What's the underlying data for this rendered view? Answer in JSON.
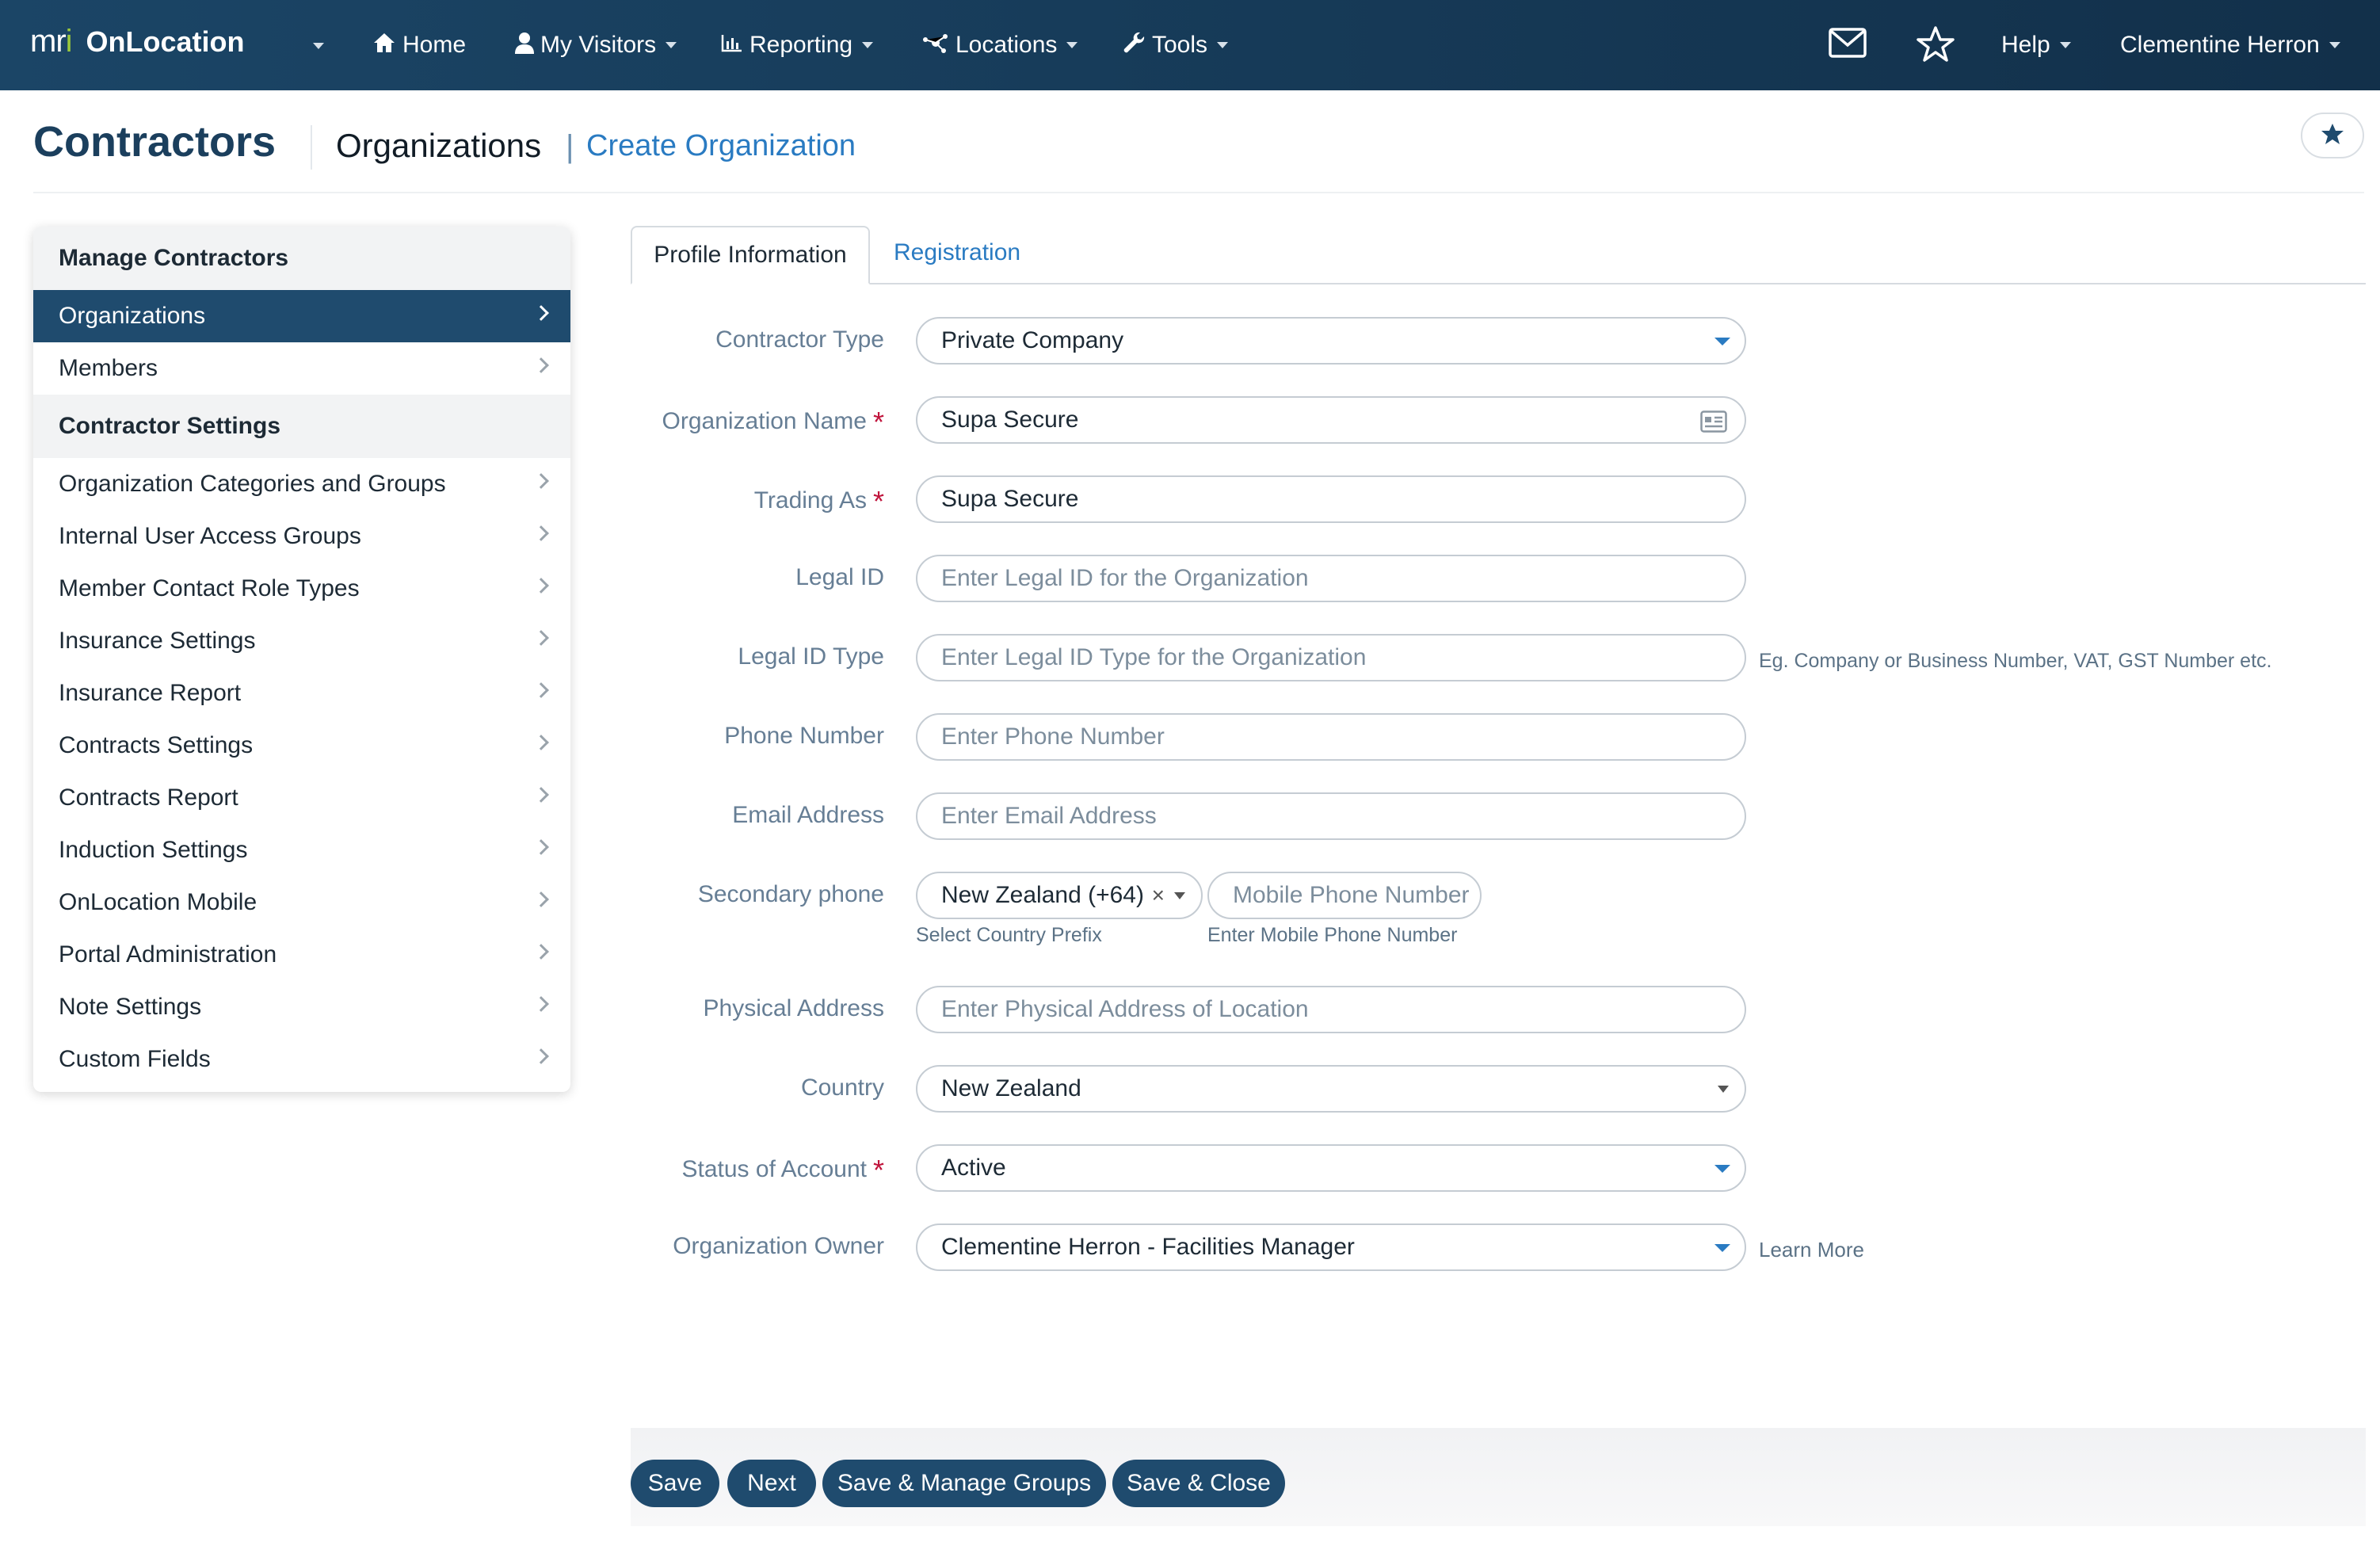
{
  "nav": {
    "logo_text": "mri",
    "app_name": "OnLocation",
    "home": "Home",
    "my_visitors": "My Visitors",
    "reporting": "Reporting",
    "locations": "Locations",
    "tools": "Tools",
    "help": "Help",
    "user": "Clementine Herron"
  },
  "header": {
    "title": "Contractors",
    "breadcrumb": "Organizations",
    "separator": "|",
    "action": "Create Organization"
  },
  "sidebar": {
    "section1": "Manage Contractors",
    "manage_items": [
      "Organizations",
      "Members"
    ],
    "section2": "Contractor Settings",
    "settings_items": [
      "Organization Categories and Groups",
      "Internal User Access Groups",
      "Member Contact Role Types",
      "Insurance Settings",
      "Insurance Report",
      "Contracts Settings",
      "Contracts Report",
      "Induction Settings",
      "OnLocation Mobile",
      "Portal Administration",
      "Note Settings",
      "Custom Fields"
    ]
  },
  "tabs": {
    "profile": "Profile Information",
    "registration": "Registration"
  },
  "form": {
    "contractor_type": {
      "label": "Contractor Type",
      "value": "Private Company"
    },
    "org_name": {
      "label": "Organization Name",
      "value": "Supa Secure"
    },
    "trading_as": {
      "label": "Trading As",
      "value": "Supa Secure"
    },
    "legal_id": {
      "label": "Legal ID",
      "placeholder": "Enter Legal ID for the Organization"
    },
    "legal_id_type": {
      "label": "Legal ID Type",
      "placeholder": "Enter Legal ID Type for the Organization",
      "hint": "Eg. Company or Business Number, VAT, GST Number etc."
    },
    "phone": {
      "label": "Phone Number",
      "placeholder": "Enter Phone Number"
    },
    "email": {
      "label": "Email Address",
      "placeholder": "Enter Email Address"
    },
    "secondary_phone": {
      "label": "Secondary phone",
      "prefix_value": "New Zealand (+64)",
      "clear": "×",
      "prefix_hint": "Select Country Prefix",
      "number_placeholder": "Mobile Phone Number",
      "number_hint": "Enter Mobile Phone Number"
    },
    "physical_address": {
      "label": "Physical Address",
      "placeholder": "Enter Physical Address of Location"
    },
    "country": {
      "label": "Country",
      "value": "New Zealand"
    },
    "status": {
      "label": "Status of Account",
      "value": "Active"
    },
    "owner": {
      "label": "Organization Owner",
      "value": "Clementine Herron - Facilities Manager",
      "link": "Learn More"
    },
    "required_mark": "*"
  },
  "buttons": {
    "save": "Save",
    "next": "Next",
    "save_manage": "Save & Manage Groups",
    "save_close": "Save & Close"
  },
  "colors": {
    "nav_bg": "#173c5a",
    "accent": "#2a7bc2",
    "primary_button": "#1f4b6e",
    "required": "#c0143c"
  },
  "icons": [
    "home-icon",
    "user-icon",
    "chart-icon",
    "locations-icon",
    "wrench-icon",
    "mail-icon",
    "star-icon",
    "id-card-icon"
  ]
}
